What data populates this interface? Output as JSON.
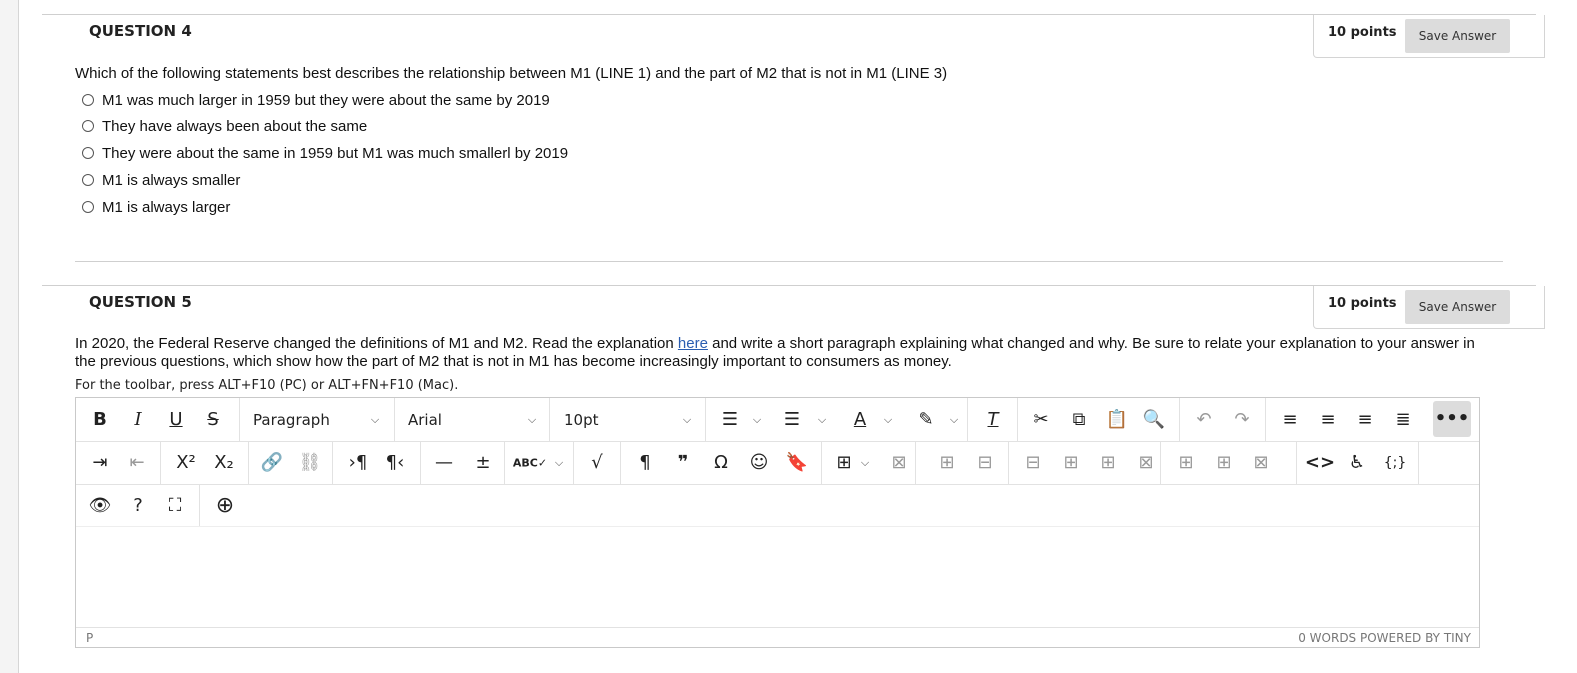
{
  "q4": {
    "title": "QUESTION 4",
    "points": "10 points",
    "save_label": "Save Answer",
    "prompt": "Which of the following statements best describes the relationship between M1 (LINE 1) and the part of M2 that is not in M1 (LINE 3)",
    "choices": [
      "M1 was much larger in 1959 but they were about the same by 2019",
      "They have always been about the same",
      "They were about the same in 1959 but M1 was much smallerl by 2019",
      "M1 is always smaller",
      "M1 is always larger"
    ]
  },
  "q5": {
    "title": "QUESTION 5",
    "points": "10 points",
    "save_label": "Save Answer",
    "prompt_before": "In 2020, the Federal Reserve changed the definitions of M1 and M2. Read the explanation ",
    "link_text": "here",
    "prompt_after": " and write a short paragraph explaining what changed and why. Be sure to relate your explanation to your answer in the previous questions, which show how the part of M2 that is not in M1 has become increasingly important to consumers as money.",
    "toolbar_hint": "For the toolbar, press ALT+F10 (PC) or ALT+FN+F10 (Mac)."
  },
  "editor": {
    "block_format": "Paragraph",
    "font_family": "Arial",
    "font_size": "10pt",
    "status_path": "P",
    "status_right": "0 WORDS  POWERED BY TINY"
  },
  "toolbar_icons": {
    "row1": [
      "bold-icon",
      "italic-icon",
      "underline-icon",
      "strikethrough-icon",
      "bullet-list-icon",
      "numbered-list-icon",
      "text-color-icon",
      "highlight-icon",
      "clear-formatting-icon",
      "cut-icon",
      "copy-icon",
      "paste-icon",
      "find-icon",
      "undo-icon",
      "redo-icon",
      "align-left-icon",
      "align-center-icon",
      "align-right-icon",
      "justify-icon",
      "more-icon"
    ],
    "row2": [
      "indent-icon",
      "outdent-icon",
      "superscript-icon",
      "subscript-icon",
      "link-icon",
      "unlink-icon",
      "ltr-icon",
      "rtl-icon",
      "horizontal-rule-icon",
      "insert-anchor-icon",
      "spellcheck-icon",
      "math-icon",
      "paragraph-mark-icon",
      "blockquote-icon",
      "special-char-icon",
      "emoji-icon",
      "bookmark-icon",
      "table-icon"
    ],
    "row3": [
      "preview-icon",
      "help-icon",
      "fullscreen-icon",
      "add-content-icon"
    ]
  }
}
